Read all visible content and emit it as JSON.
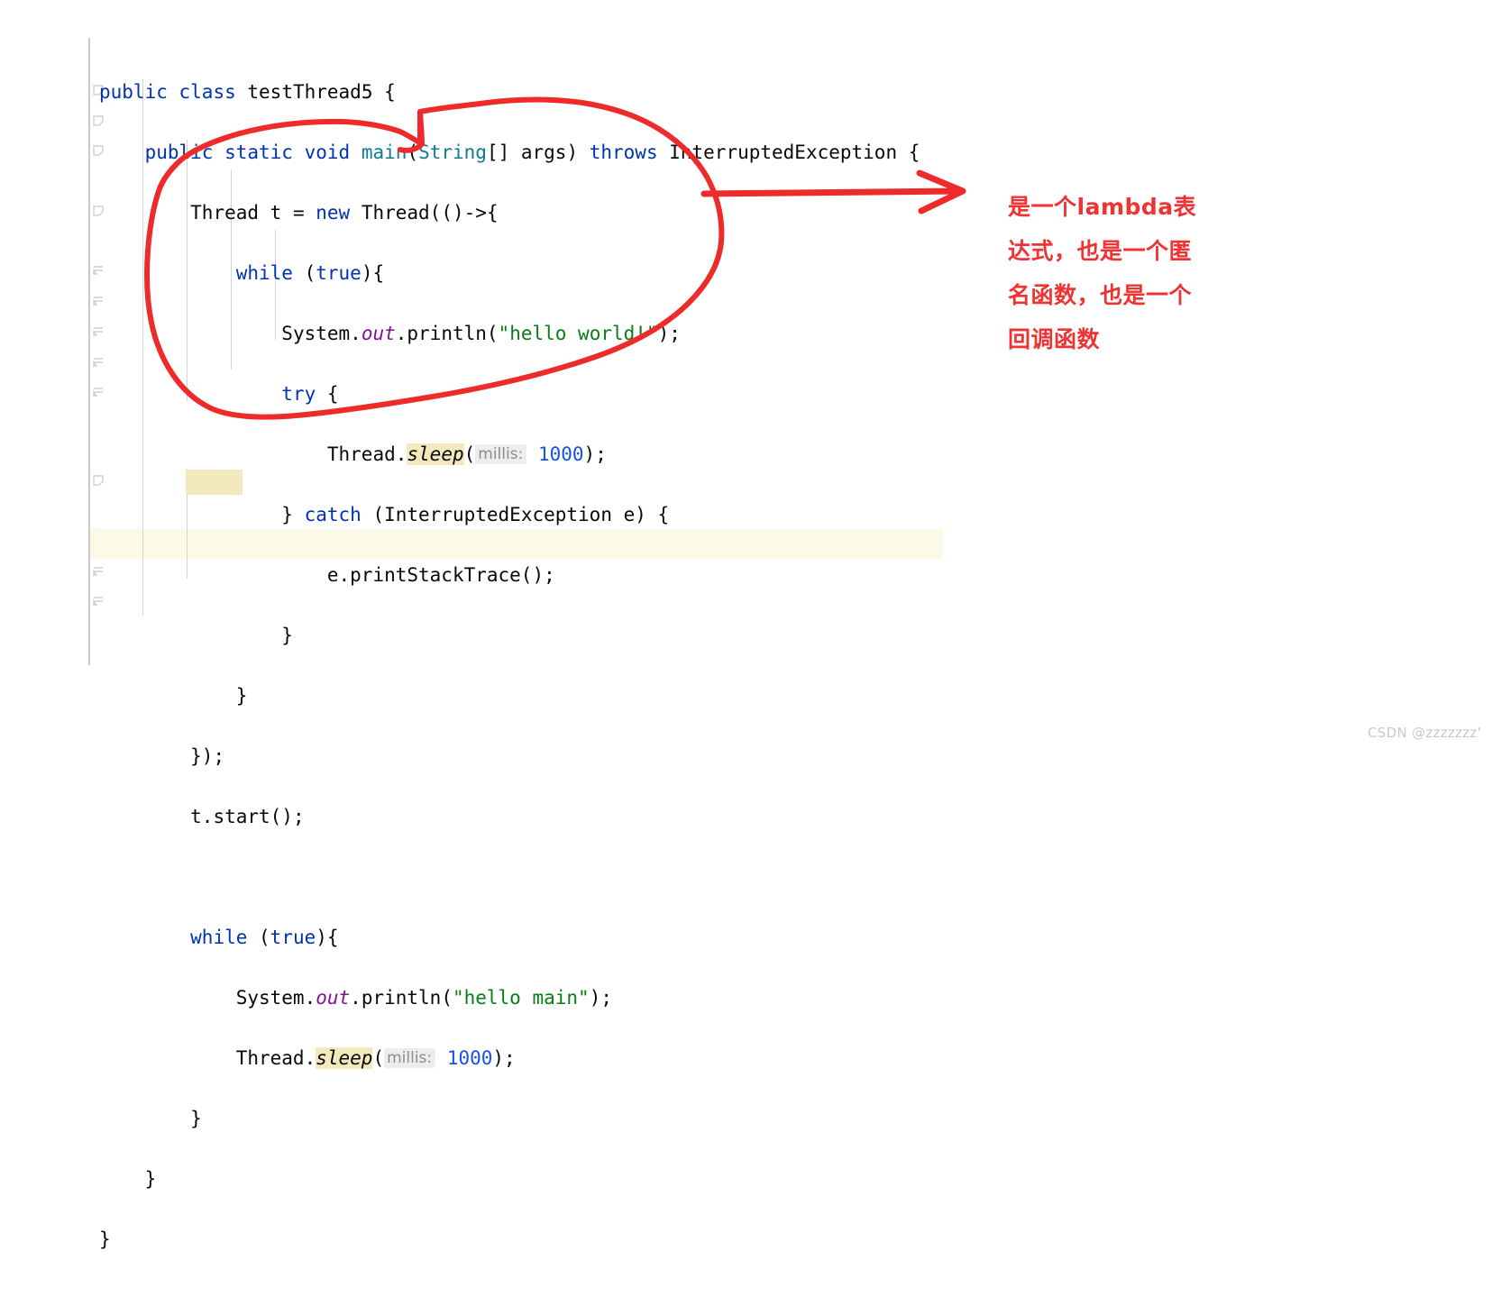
{
  "editor": {
    "language": "java",
    "background": "#ffffff",
    "current_line_highlight_color": "#fdf9e7",
    "identifier_highlight_color": "#f3e9bd",
    "code_lines": [
      {
        "indent": 0,
        "text": "public class testThread5 {"
      },
      {
        "indent": 1,
        "text": "public static void main(String[] args) throws InterruptedException {"
      },
      {
        "indent": 2,
        "text": "Thread t = new Thread(()->{"
      },
      {
        "indent": 3,
        "text": "while (true){"
      },
      {
        "indent": 4,
        "text": "System.out.println(\"hello world!\");"
      },
      {
        "indent": 4,
        "text": "try {"
      },
      {
        "indent": 5,
        "text": "Thread.sleep( millis: 1000);"
      },
      {
        "indent": 4,
        "text": "} catch (InterruptedException e) {"
      },
      {
        "indent": 5,
        "text": "e.printStackTrace();"
      },
      {
        "indent": 4,
        "text": "}"
      },
      {
        "indent": 3,
        "text": "}"
      },
      {
        "indent": 2,
        "text": "});"
      },
      {
        "indent": 2,
        "text": "t.start();"
      },
      {
        "indent": 0,
        "text": ""
      },
      {
        "indent": 2,
        "text": "while (true){"
      },
      {
        "indent": 3,
        "text": "System.out.println(\"hello main\");"
      },
      {
        "indent": 3,
        "text": "Thread.sleep( millis: 1000);"
      },
      {
        "indent": 2,
        "text": "}"
      },
      {
        "indent": 1,
        "text": "}"
      },
      {
        "indent": 0,
        "text": "}"
      }
    ],
    "tokens": {
      "keyword_public": "public",
      "keyword_class": "class",
      "keyword_static": "static",
      "keyword_void": "void",
      "keyword_new": "new",
      "keyword_while": "while",
      "keyword_true": "true",
      "keyword_try": "try",
      "keyword_catch": "catch",
      "keyword_throws": "throws",
      "class_name": "testThread5",
      "method_main": "main",
      "type_string": "String",
      "args": "args",
      "exception_type": "InterruptedException",
      "type_thread": "Thread",
      "var_t": "t",
      "lambda_arrow": "()->",
      "system": "System",
      "field_out": "out",
      "method_println": "println",
      "string_hello_world": "\"hello world!\"",
      "string_hello_main": "\"hello main\"",
      "method_sleep": "sleep",
      "param_hint_millis": "millis:",
      "number_1000": "1000",
      "var_e": "e",
      "method_print_stack_trace": "printStackTrace",
      "method_start": "start"
    },
    "syntax_colors": {
      "keyword": "#0033b3",
      "class_reference": "#0f7c8f",
      "string": "#067d17",
      "number": "#1750eb",
      "static_field": "#871094",
      "default_text": "#080808",
      "param_hint_text": "#8c8c8c",
      "param_hint_background": "#ededed"
    }
  },
  "annotations": {
    "color": "#ee2b2b",
    "lasso_label": "hand-drawn-circle-around-lambda-body",
    "arrow_label": "hand-drawn-arrow-pointing-right",
    "note_lines": [
      "是一个lambda表",
      "达式，也是一个匿",
      "名函数，也是一个",
      "回调函数"
    ],
    "note_color": "#ef3333"
  },
  "watermark": {
    "text": "CSDN @zzzzzzz'",
    "color": "#c8c8c8"
  }
}
